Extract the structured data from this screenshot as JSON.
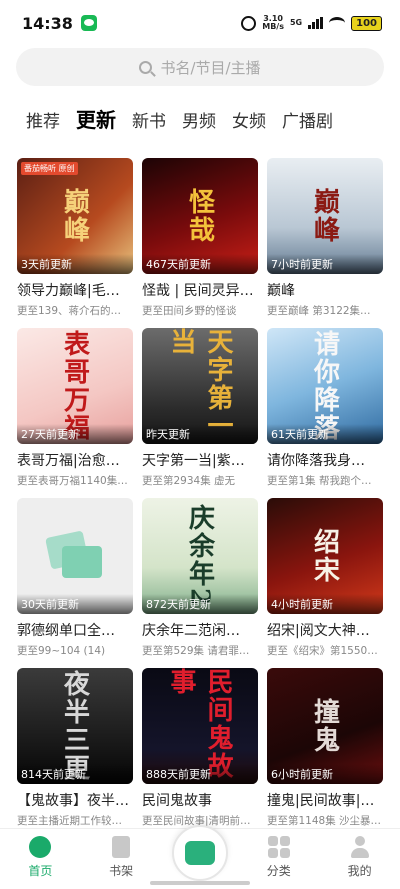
{
  "status": {
    "time": "14:38",
    "net_speed_top": "3.10",
    "net_speed_bottom": "MB/s",
    "network": "5G",
    "battery": "100"
  },
  "search": {
    "placeholder": "书名/节目/主播"
  },
  "tabs": [
    "推荐",
    "更新",
    "新书",
    "男频",
    "女频",
    "广播剧"
  ],
  "active_tab": "更新",
  "cards": [
    {
      "art": "巅峰",
      "badge": "3天前更新",
      "tag": "番茄畅听 原创",
      "title": "领导力巅峰|毛…",
      "sub": "更至139、蒋介石的…",
      "bg": "linear-gradient(135deg,#5b1f14,#b64a1f 60%,#e8c27d)",
      "color": "#f6d17a"
    },
    {
      "art": "怪哉",
      "badge": "467天前更新",
      "title": "怪哉 | 民间灵异…",
      "sub": "更至田间乡野的怪谈",
      "bg": "linear-gradient(160deg,#1c0405,#7a0b0c 55%,#c81f17)",
      "color": "#f4c23b"
    },
    {
      "art": "巅峰",
      "badge": "7小时前更新",
      "title": "巅峰",
      "sub": "更至巅峰 第3122集…",
      "bg": "linear-gradient(180deg,#e9eef2,#b9c7d4 60%,#60788f)",
      "color": "#8b1a13"
    },
    {
      "art": "表哥万福",
      "badge": "27天前更新",
      "title": "表哥万福|治愈…",
      "sub": "更至表哥万福1140集…",
      "bg": "linear-gradient(160deg,#fbe9e6,#f4c7c3 60%,#e7a09d)",
      "color": "#c0191a"
    },
    {
      "art": "天字第一当",
      "badge": "昨天更新",
      "title": "天字第一当|紫…",
      "sub": "更至第2934集 虚无",
      "bg": "linear-gradient(180deg,#6c6c6c,#2b2b2b 70%,#151515)",
      "color": "#e8b23a"
    },
    {
      "art": "请你降落",
      "badge": "61天前更新",
      "title": "请你降落我身…",
      "sub": "更至第1集 帮我跑个…",
      "bg": "linear-gradient(160deg,#cfe6f7,#7fb6de 50%,#2f6aa0)",
      "color": "#f7f7f7"
    },
    {
      "art": "",
      "badge": "30天前更新",
      "title": "郭德纲单口全…",
      "sub": "更至99~104 (14)",
      "bg": "#eeeeee",
      "color": "#7fd0b2",
      "placeholder": true
    },
    {
      "art": "庆余年2",
      "badge": "872天前更新",
      "title": "庆余年二范闲…",
      "sub": "更至第529集 请君罪…",
      "bg": "linear-gradient(180deg,#eef3e6,#d4e4c9 60%,#7fae8a)",
      "color": "#1a3d2a"
    },
    {
      "art": "绍宋",
      "badge": "4小时前更新",
      "title": "绍宋|阅文大神…",
      "sub": "更至《绍宋》第1550…",
      "bg": "linear-gradient(160deg,#2a0c08,#8a150e 55%,#d23a1b)",
      "color": "#f7f1e6"
    },
    {
      "art": "夜半三更",
      "badge": "814天前更新",
      "title": "【鬼故事】夜半…",
      "sub": "更至主播近期工作较…",
      "bg": "linear-gradient(180deg,#3b3b3b,#161616 70%,#050505)",
      "color": "#d8d8d8"
    },
    {
      "art": "民间鬼故事",
      "badge": "888天前更新",
      "title": "民间鬼故事",
      "sub": "更至民间故事|清明前…",
      "bg": "linear-gradient(180deg,#0a0a14,#14142a 70%,#220a0a)",
      "color": "#e01e2d"
    },
    {
      "art": "撞鬼",
      "badge": "6小时前更新",
      "title": "撞鬼|民间故事|…",
      "sub": "更至第1148集 沙尘暴…",
      "bg": "linear-gradient(160deg,#3a0a0a,#1c0606 60%,#6b0e0e)",
      "color": "#e3dad6"
    }
  ],
  "bottom_nav": {
    "home": "首页",
    "shelf": "书架",
    "category": "分类",
    "mine": "我的"
  },
  "colors": {
    "accent": "#1aaa6a"
  }
}
